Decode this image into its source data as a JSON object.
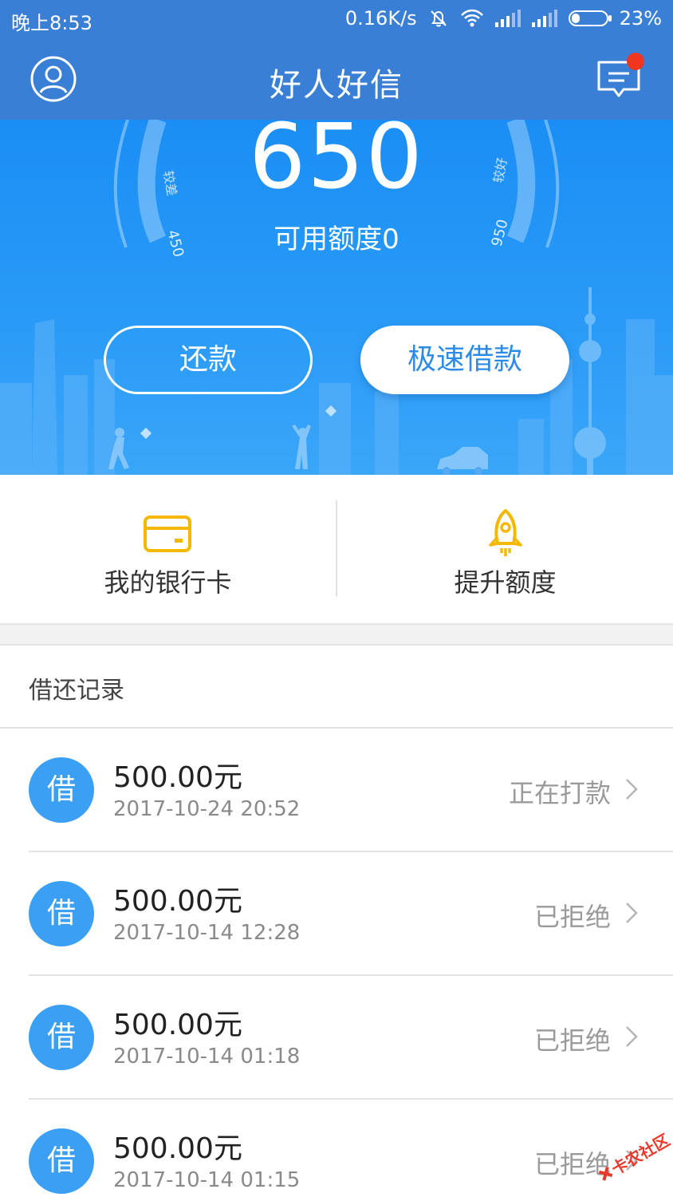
{
  "status_bar": {
    "time": "晚上8:53",
    "net_speed": "0.16K/s",
    "battery": "23%",
    "battery_level": 0.23,
    "icons": [
      "mute-bell-icon",
      "wifi-icon",
      "signal-icon",
      "signal-icon",
      "battery-icon"
    ]
  },
  "header": {
    "title": "好人好信",
    "left_icon": "user-icon",
    "right_icon": "message-icon",
    "has_unread": true
  },
  "credit": {
    "score": "650",
    "available_label": "可用额度0",
    "gauge_left_label": "较差",
    "gauge_left_value": "450",
    "gauge_right_label": "较好",
    "gauge_right_value": "950"
  },
  "buttons": {
    "repay": "还款",
    "fast_loan": "极速借款"
  },
  "actions": [
    {
      "label": "我的银行卡",
      "icon": "bank-card-icon"
    },
    {
      "label": "提升额度",
      "icon": "rocket-icon"
    }
  ],
  "records": {
    "title": "借还记录",
    "items": [
      {
        "badge": "借",
        "amount": "500.00元",
        "date": "2017-10-24 20:52",
        "status": "正在打款"
      },
      {
        "badge": "借",
        "amount": "500.00元",
        "date": "2017-10-14 12:28",
        "status": "已拒绝"
      },
      {
        "badge": "借",
        "amount": "500.00元",
        "date": "2017-10-14 01:18",
        "status": "已拒绝"
      },
      {
        "badge": "借",
        "amount": "500.00元",
        "date": "2017-10-14 01:15",
        "status": "已拒绝"
      }
    ]
  },
  "watermark": "卡农社区",
  "colors": {
    "header_bg": "#3a7fd6",
    "hero_bg": "#1b8ef5",
    "badge": "#3b9ff4",
    "accent_yellow": "#f5b800",
    "notification_dot": "#f0361f"
  }
}
